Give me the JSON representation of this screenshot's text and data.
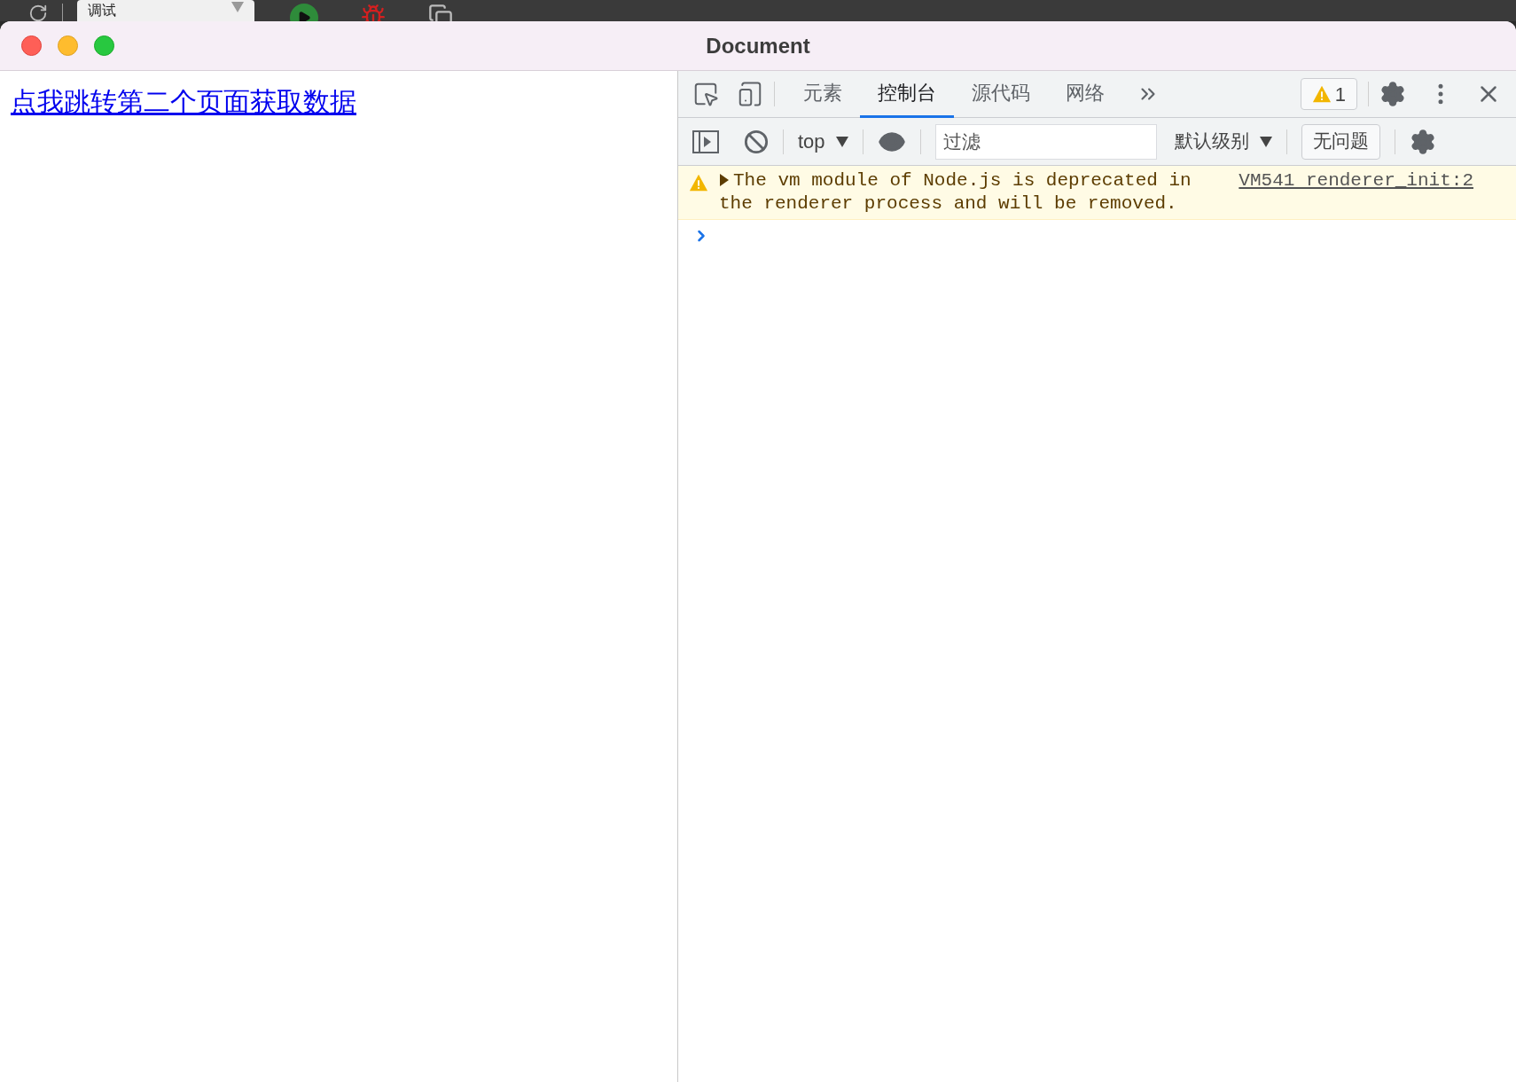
{
  "ide_toolbar": {
    "config_select": "调试"
  },
  "window": {
    "title": "Document"
  },
  "page": {
    "link": "点我跳转第二个页面获取数据"
  },
  "devtools": {
    "tabs": [
      {
        "label": "元素",
        "selected": false
      },
      {
        "label": "控制台",
        "selected": true
      },
      {
        "label": "源代码",
        "selected": false
      },
      {
        "label": "网络",
        "selected": false
      }
    ],
    "warning_count": "1",
    "console_toolbar": {
      "context": "top",
      "filter_placeholder": "过滤",
      "level": "默认级别",
      "issues": "无问题"
    },
    "messages": [
      {
        "kind": "warning",
        "text": "The vm module of Node.js is deprecated in the renderer process and will be removed.",
        "source": "VM541 renderer_init:2"
      }
    ]
  }
}
